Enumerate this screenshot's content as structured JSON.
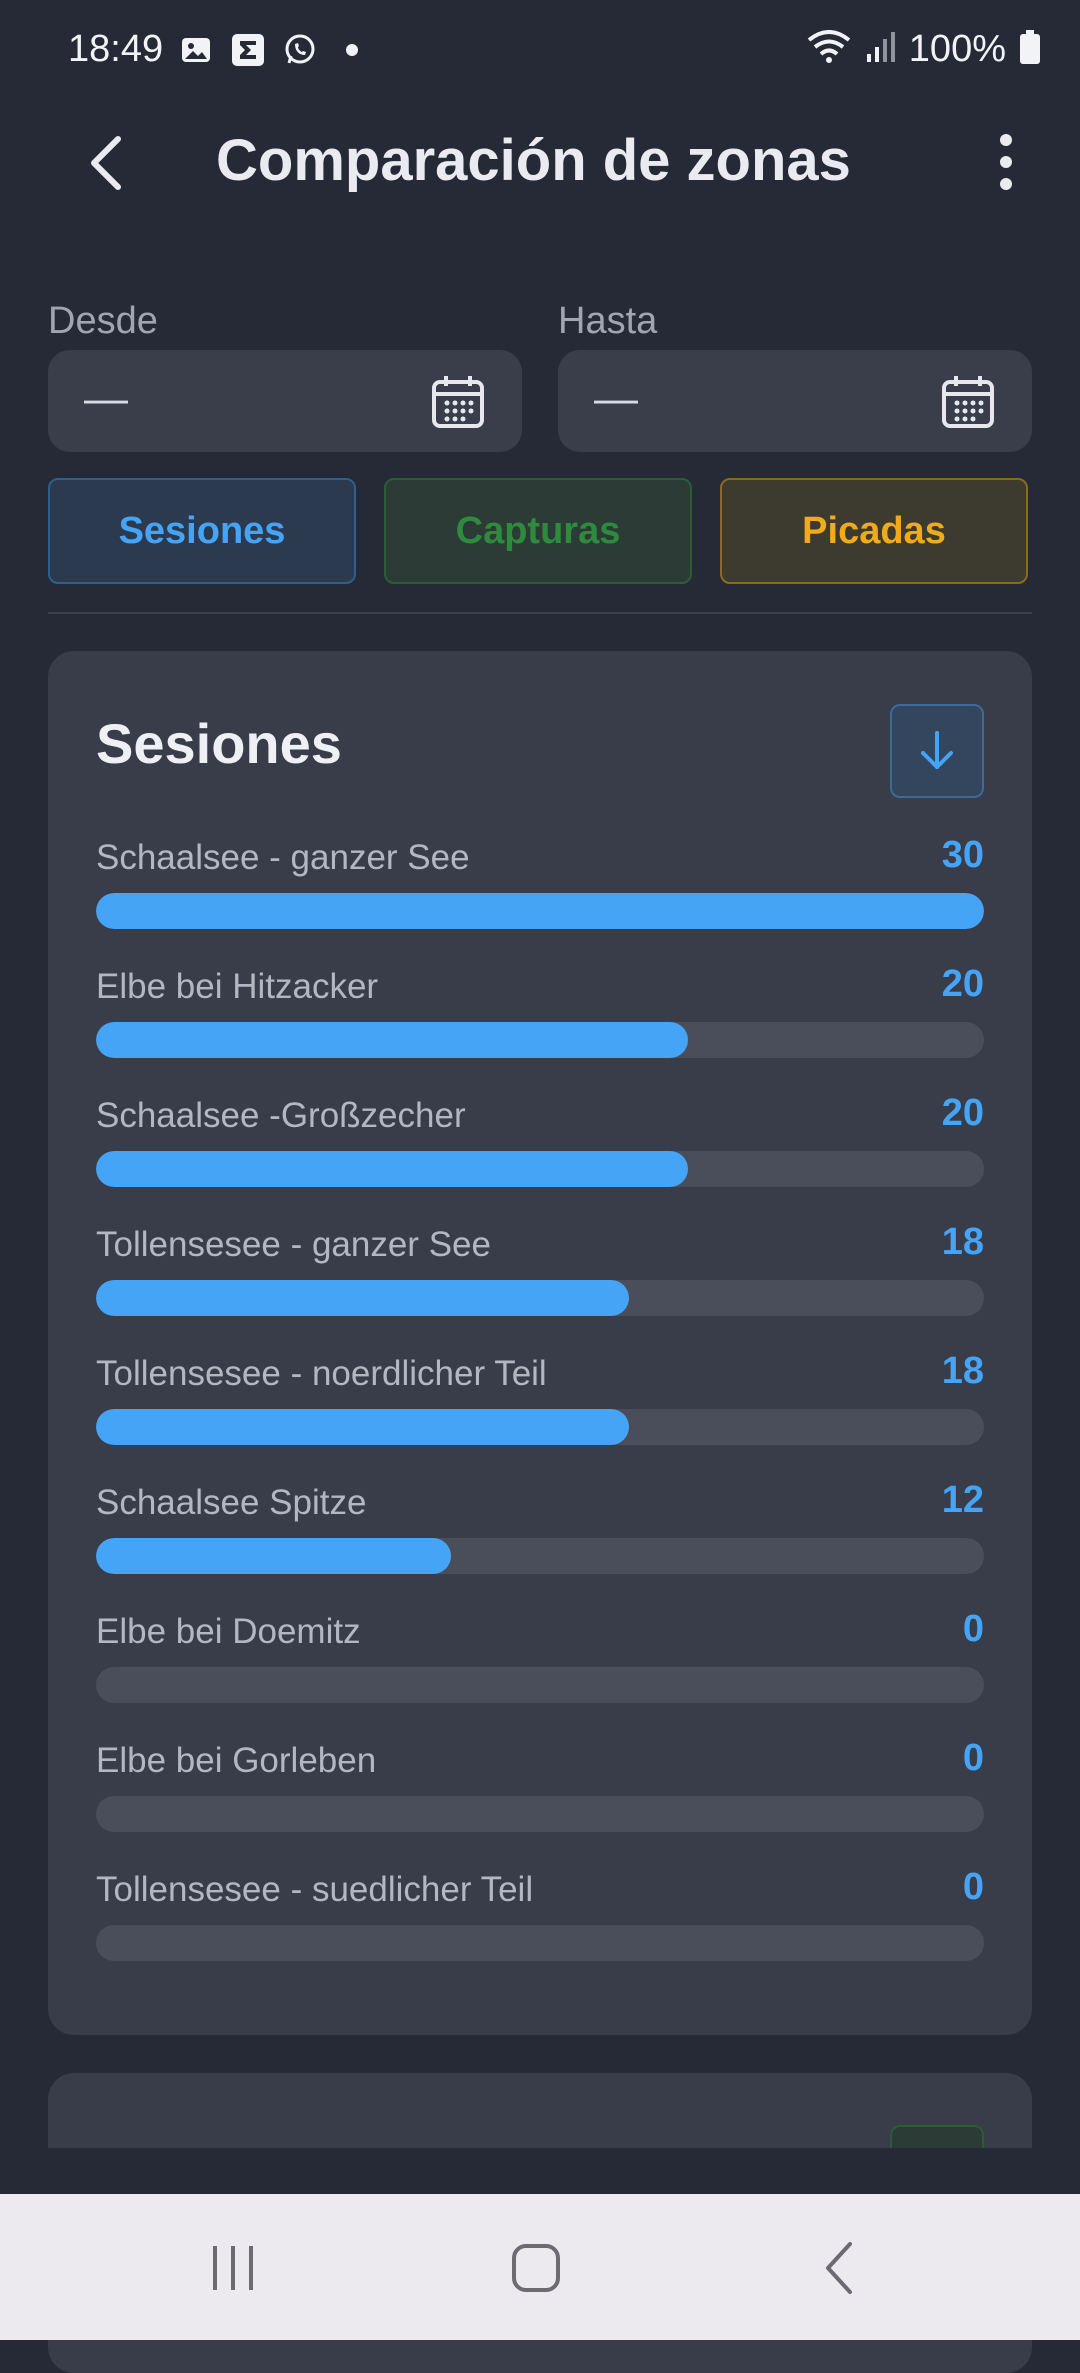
{
  "status_bar": {
    "time": "18:49",
    "battery": "100%",
    "left_icons": [
      "image-icon",
      "sigma-icon",
      "whatsapp-icon",
      "dot-icon"
    ],
    "right_icons": [
      "wifi-icon",
      "signal-icon",
      "battery-icon"
    ]
  },
  "app_bar": {
    "title": "Comparación de zonas",
    "back_icon": "back-arrow-icon",
    "menu_icon": "more-vertical-icon"
  },
  "date_range": {
    "from_label": "Desde",
    "from_value": "—",
    "to_label": "Hasta",
    "to_value": "—"
  },
  "filters": [
    {
      "label": "Sesiones",
      "color": "#45a4f5",
      "active": true
    },
    {
      "label": "Capturas",
      "color": "#2e8b3e",
      "active": false
    },
    {
      "label": "Picadas",
      "color": "#efab1a",
      "active": false
    }
  ],
  "card": {
    "title": "Sesiones",
    "sort_icon": "arrow-down-icon",
    "accent": "#45a4f5",
    "max_value": 30,
    "zones": [
      {
        "name": "Schaalsee - ganzer See",
        "value": 30
      },
      {
        "name": "Elbe bei Hitzacker",
        "value": 20
      },
      {
        "name": "Schaalsee -Großzecher",
        "value": 20
      },
      {
        "name": "Tollensesee - ganzer See",
        "value": 18
      },
      {
        "name": "Tollensesee - noerdlicher Teil",
        "value": 18
      },
      {
        "name": "Schaalsee Spitze",
        "value": 12
      },
      {
        "name": "Elbe bei Doemitz",
        "value": 0
      },
      {
        "name": "Elbe bei Gorleben",
        "value": 0
      },
      {
        "name": "Tollensesee - suedlicher Teil",
        "value": 0
      }
    ]
  },
  "nav_bar": {
    "recents_icon": "recents-icon",
    "home_icon": "home-icon",
    "back_icon": "nav-back-icon"
  }
}
